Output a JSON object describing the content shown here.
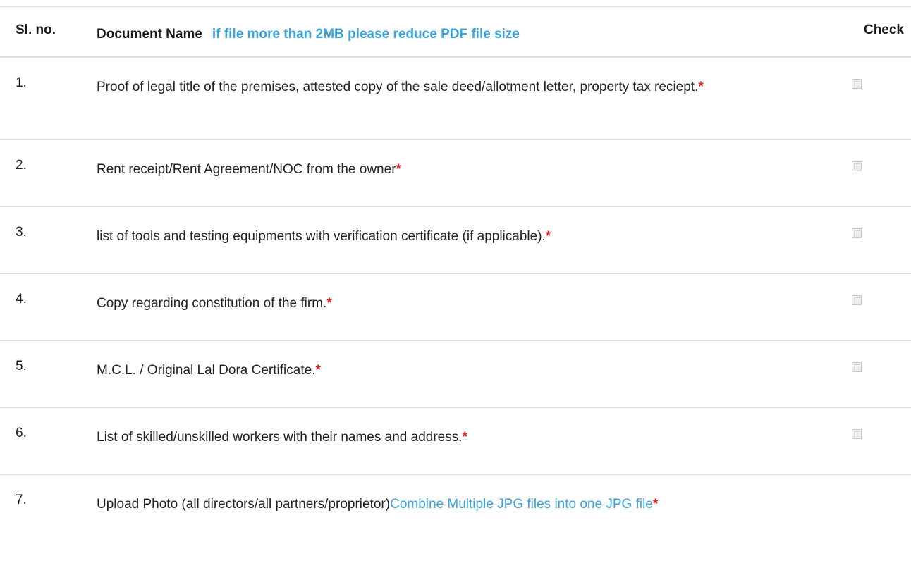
{
  "header": {
    "sl_no": "Sl. no.",
    "document_name": "Document Name",
    "note": "if file more than 2MB please reduce PDF file size",
    "check": "Check"
  },
  "required_marker": "*",
  "rows": [
    {
      "sl": "1.",
      "text": "Proof of legal title of the premises, attested copy of the sale deed/allotment letter, property tax reciept.",
      "checked": false
    },
    {
      "sl": "2.",
      "text": "Rent receipt/Rent Agreement/NOC from the owner",
      "checked": false
    },
    {
      "sl": "3.",
      "text": "list of tools and testing equipments with verification certificate (if applicable).",
      "checked": false
    },
    {
      "sl": "4.",
      "text": "Copy regarding constitution of the firm.",
      "checked": false
    },
    {
      "sl": "5.",
      "text": "M.C.L. / Original Lal Dora Certificate.",
      "checked": false
    },
    {
      "sl": "6.",
      "text": "List of skilled/unskilled workers with their names and address.",
      "checked": false
    },
    {
      "sl": "7.",
      "text": "Upload Photo (all directors/all partners/proprietor)",
      "link": "Combine Multiple JPG files into one JPG file"
    }
  ],
  "colors": {
    "accent_blue": "#3aa3dc",
    "required_red": "#e02020",
    "divider": "#dcdcdc"
  }
}
